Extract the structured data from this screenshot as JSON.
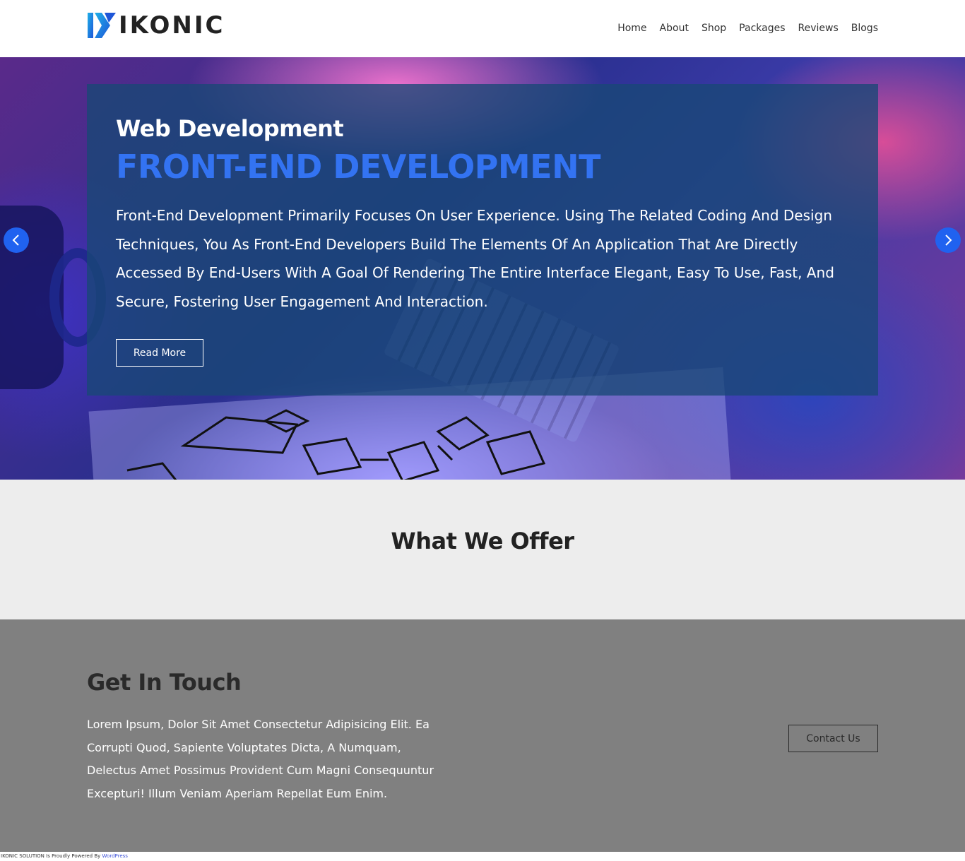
{
  "header": {
    "logo_text": "IKONIC",
    "nav": [
      "Home",
      "About",
      "Shop",
      "Packages",
      "Reviews",
      "Blogs"
    ]
  },
  "hero": {
    "subtitle": "Web Development",
    "title": "FRONT-END DEVELOPMENT",
    "description": "Front-End Development Primarily Focuses On User Experience. Using The Related Coding And Design Techniques, You As Front-End Developers Build The Elements Of An Application That Are Directly Accessed By End-Users With A Goal Of Rendering The Entire Interface Elegant, Easy To Use, Fast, And Secure, Fostering User Engagement And Interaction.",
    "button_label": "Read More"
  },
  "offer": {
    "title": "What We Offer"
  },
  "contact": {
    "title": "Get In Touch",
    "text": "Lorem Ipsum, Dolor Sit Amet Consectetur Adipisicing Elit. Ea Corrupti Quod, Sapiente Voluptates Dicta, A Numquam, Delectus Amet Possimus Provident Cum Magni Consequuntur Excepturi! Illum Veniam Aperiam Repellat Eum Enim.",
    "button_label": "Contact Us"
  },
  "footer": {
    "text": "IKONIC SOLUTION Is Proudly Powered By ",
    "link_label": "WordPress"
  },
  "colors": {
    "accent_blue": "#3373f2",
    "arrow_blue": "#2062f0",
    "overlay": "#184876",
    "offer_bg": "#ededed",
    "contact_bg": "#808080"
  },
  "icons": {
    "prev": "chevron-left-icon",
    "next": "chevron-right-icon"
  }
}
